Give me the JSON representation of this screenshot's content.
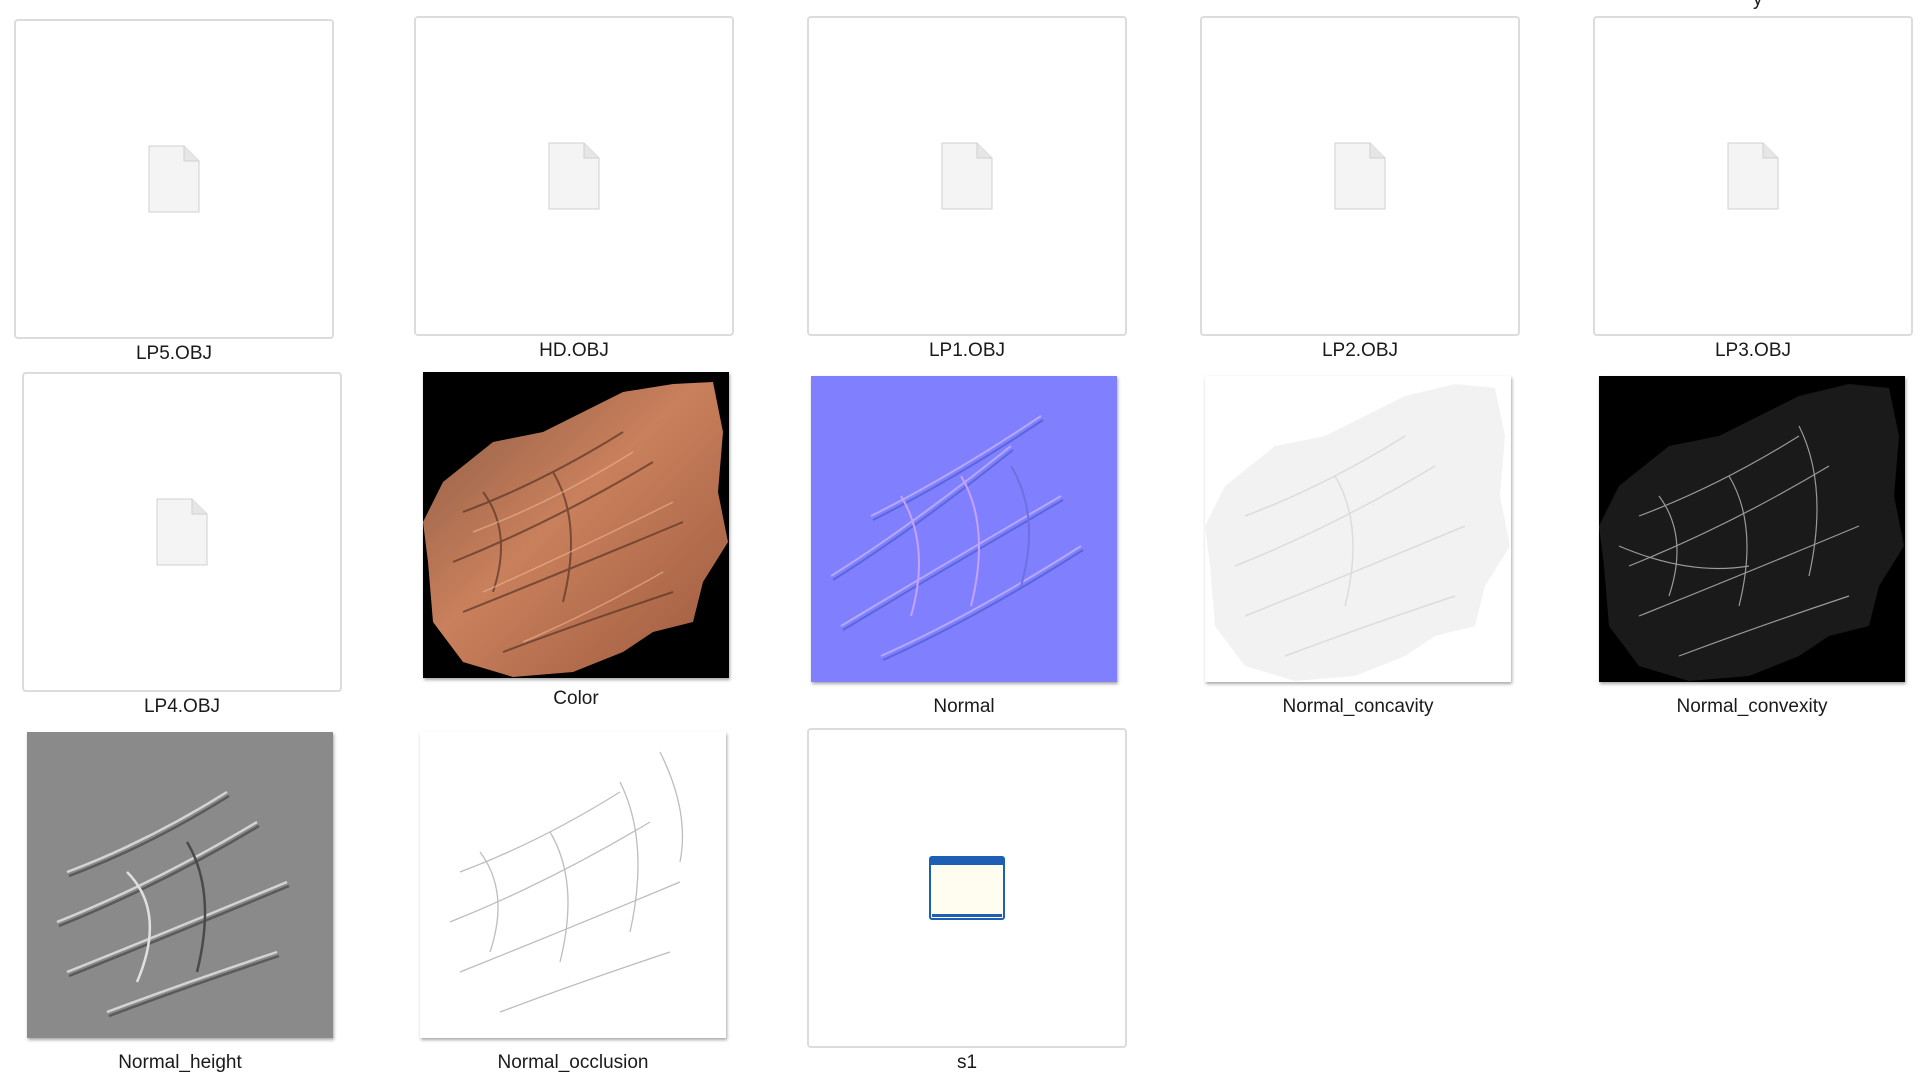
{
  "folder": {
    "items": [
      {
        "name": "LP5.OBJ",
        "kind": "obj-file",
        "icon": "generic-file-icon"
      },
      {
        "name": "HD.OBJ",
        "kind": "obj-file",
        "icon": "generic-file-icon"
      },
      {
        "name": "LP1.OBJ",
        "kind": "obj-file",
        "icon": "generic-file-icon"
      },
      {
        "name": "LP2.OBJ",
        "kind": "obj-file",
        "icon": "generic-file-icon"
      },
      {
        "name": "LP3.OBJ",
        "kind": "obj-file",
        "icon": "generic-file-icon"
      },
      {
        "name": "LP4.OBJ",
        "kind": "obj-file",
        "icon": "generic-file-icon"
      },
      {
        "name": "Color",
        "kind": "image",
        "thumbnail": "color-texture-rock"
      },
      {
        "name": "Normal",
        "kind": "image",
        "thumbnail": "normal-map-blue"
      },
      {
        "name": "Normal_concavity",
        "kind": "image",
        "thumbnail": "concavity-map-light"
      },
      {
        "name": "Normal_convexity",
        "kind": "image",
        "thumbnail": "convexity-map-dark"
      },
      {
        "name": "Normal_height",
        "kind": "image",
        "thumbnail": "height-map-gray"
      },
      {
        "name": "Normal_occlusion",
        "kind": "image",
        "thumbnail": "occlusion-map-white"
      },
      {
        "name": "s1",
        "kind": "application",
        "icon": "application-window-icon"
      }
    ],
    "top_cut_label": "y"
  },
  "colors": {
    "normal_blue": "#8080ff",
    "rock_orange": "#c0714f",
    "height_gray": "#8a8a8a",
    "window_blue": "#1c5fb4"
  }
}
